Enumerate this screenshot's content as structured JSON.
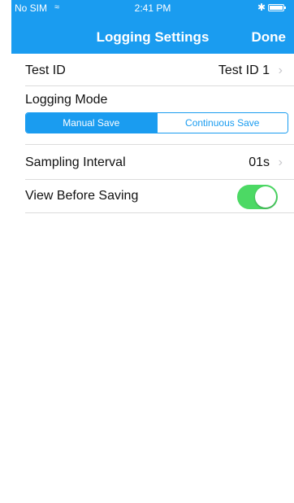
{
  "status_bar": {
    "carrier": "No SIM",
    "time": "2:41 PM"
  },
  "nav": {
    "title": "Logging Settings",
    "done_label": "Done"
  },
  "test_id": {
    "label": "Test ID",
    "value": "Test ID 1"
  },
  "logging_mode": {
    "label": "Logging Mode",
    "options": [
      "Manual Save",
      "Continuous Save"
    ],
    "selected": "Manual Save"
  },
  "sampling_interval": {
    "label": "Sampling Interval",
    "value": "01s"
  },
  "view_before_saving": {
    "label": "View Before Saving",
    "enabled": true
  },
  "colors": {
    "accent": "#1a9cf0",
    "toggle_on": "#4cd964"
  }
}
